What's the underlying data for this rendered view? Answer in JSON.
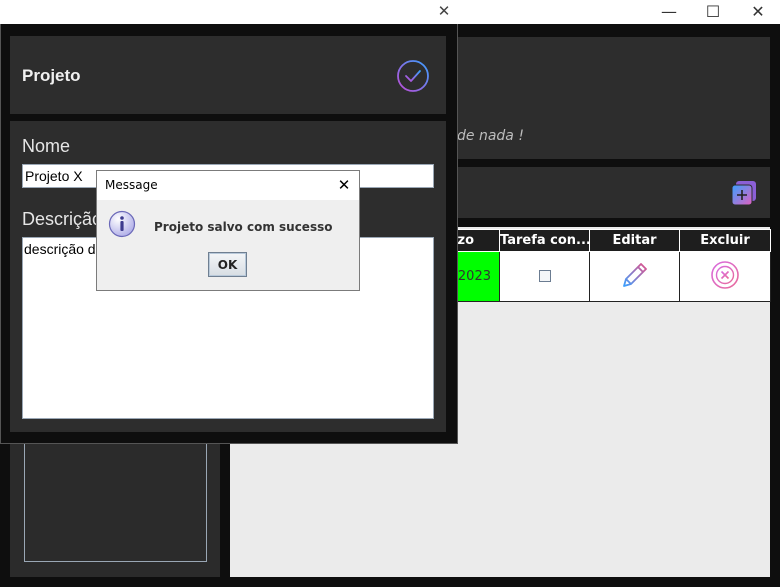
{
  "main_window": {
    "subtitle": "de nada !",
    "controls": {
      "minimize": "—",
      "maximize": "☐",
      "close": "✕"
    },
    "table": {
      "columns": [
        "zo",
        "Tarefa con...",
        "Editar",
        "Excluir"
      ],
      "rows": [
        {
          "deadline": "2023",
          "completed": false
        }
      ]
    }
  },
  "project_dialog": {
    "close": "✕",
    "title": "Projeto",
    "name_label": "Nome",
    "name_value": "Projeto X",
    "description_label": "Descrição",
    "description_value": "descrição do"
  },
  "message_box": {
    "title": "Message",
    "close": "✕",
    "text": "Projeto salvo com sucesso",
    "ok_label": "OK"
  },
  "colors": {
    "panel": "#2d2d2d",
    "deadline_ok": "#00ff00",
    "accent_gradient_start": "#3aa0ff",
    "accent_gradient_end": "#c04bd6"
  }
}
